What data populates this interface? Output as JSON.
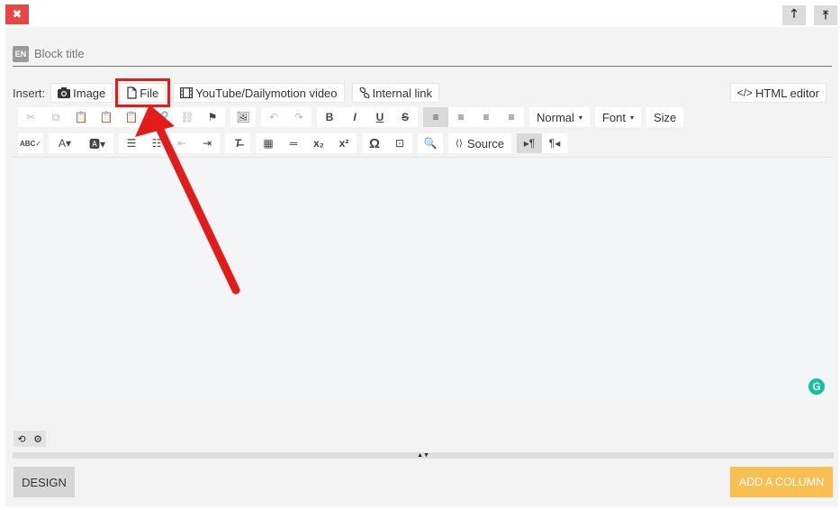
{
  "topbar": {
    "close_glyph": "✖",
    "move_up_glyph": "🡑",
    "move_top_glyph": "⤒"
  },
  "block": {
    "lang_badge": "EN",
    "title_placeholder": "Block title"
  },
  "insert": {
    "label": "Insert:",
    "image": "Image",
    "file": "File",
    "video": "YouTube/Dailymotion video",
    "internal_link": "Internal link",
    "html_editor": "HTML editor"
  },
  "toolbar": {
    "format_label": "Normal",
    "font_label": "Font",
    "size_label": "Size",
    "source_label": "Source",
    "subscript": "x₂",
    "superscript": "x²",
    "omega": "Ω"
  },
  "grammarly": {
    "letter": "G"
  },
  "footer": {
    "design_label": "DESIGN",
    "add_column_label": "ADD A COLUMN"
  },
  "colors": {
    "close": "#e84545",
    "highlight": "#e21b1b",
    "add_column": "#f8bf52",
    "grammarly": "#15c39a"
  }
}
